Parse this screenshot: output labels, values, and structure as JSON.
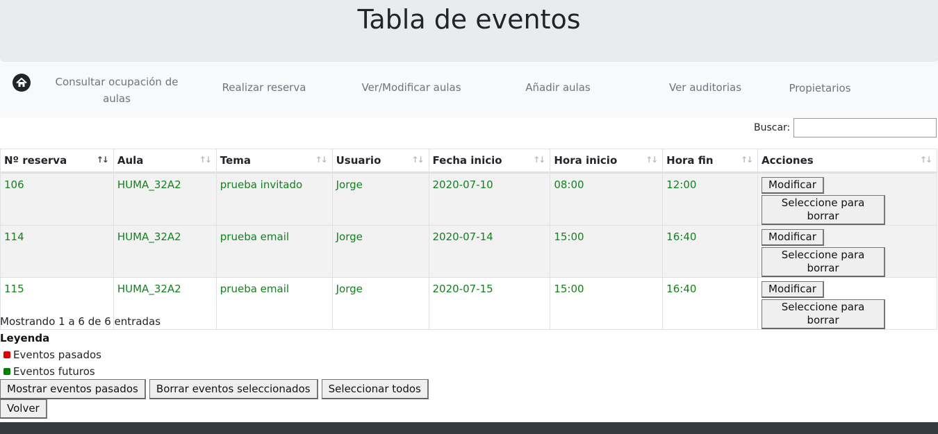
{
  "header": {
    "title": "Tabla de eventos"
  },
  "nav": {
    "home_icon": "home-icon",
    "items": [
      {
        "label": "Consultar ocupación de aulas"
      },
      {
        "label": "Realizar reserva"
      },
      {
        "label": "Ver/Modificar aulas"
      },
      {
        "label": "Añadir aulas"
      },
      {
        "label": "Ver auditorias"
      },
      {
        "label": "Propietarios"
      }
    ]
  },
  "search": {
    "label": "Buscar:",
    "value": ""
  },
  "table": {
    "columns": [
      "Nº reserva",
      "Aula",
      "Tema",
      "Usuario",
      "Fecha inicio",
      "Hora inicio",
      "Hora fin",
      "Acciones"
    ],
    "sorted_column": "Nº reserva",
    "rows": [
      {
        "id": "106",
        "aula": "HUMA_32A2",
        "tema": "prueba invitado",
        "usuario": "Jorge",
        "fecha": "2020-07-10",
        "inicio": "08:00",
        "fin": "12:00"
      },
      {
        "id": "114",
        "aula": "HUMA_32A2",
        "tema": "prueba email",
        "usuario": "Jorge",
        "fecha": "2020-07-14",
        "inicio": "15:00",
        "fin": "16:40"
      },
      {
        "id": "115",
        "aula": "HUMA_32A2",
        "tema": "prueba email",
        "usuario": "Jorge",
        "fecha": "2020-07-15",
        "inicio": "15:00",
        "fin": "16:40"
      }
    ],
    "row_actions": {
      "modify": "Modificar",
      "select_delete": "Seleccione para borrar"
    }
  },
  "info": "Mostrando 1 a 6 de 6 entradas",
  "legend": {
    "title": "Leyenda",
    "items": [
      {
        "label": "Eventos pasados",
        "color": "#e00000"
      },
      {
        "label": "Eventos futuros",
        "color": "#008000"
      }
    ]
  },
  "buttons": {
    "show_past": "Mostrar eventos pasados",
    "delete_selected": "Borrar eventos seleccionados",
    "select_all": "Seleccionar todos",
    "back": "Volver"
  },
  "colors": {
    "future_event_text": "#11821c",
    "header_bg": "#e9ecef",
    "nav_bg": "#f8f9fa",
    "footer_bg": "#343a40"
  }
}
